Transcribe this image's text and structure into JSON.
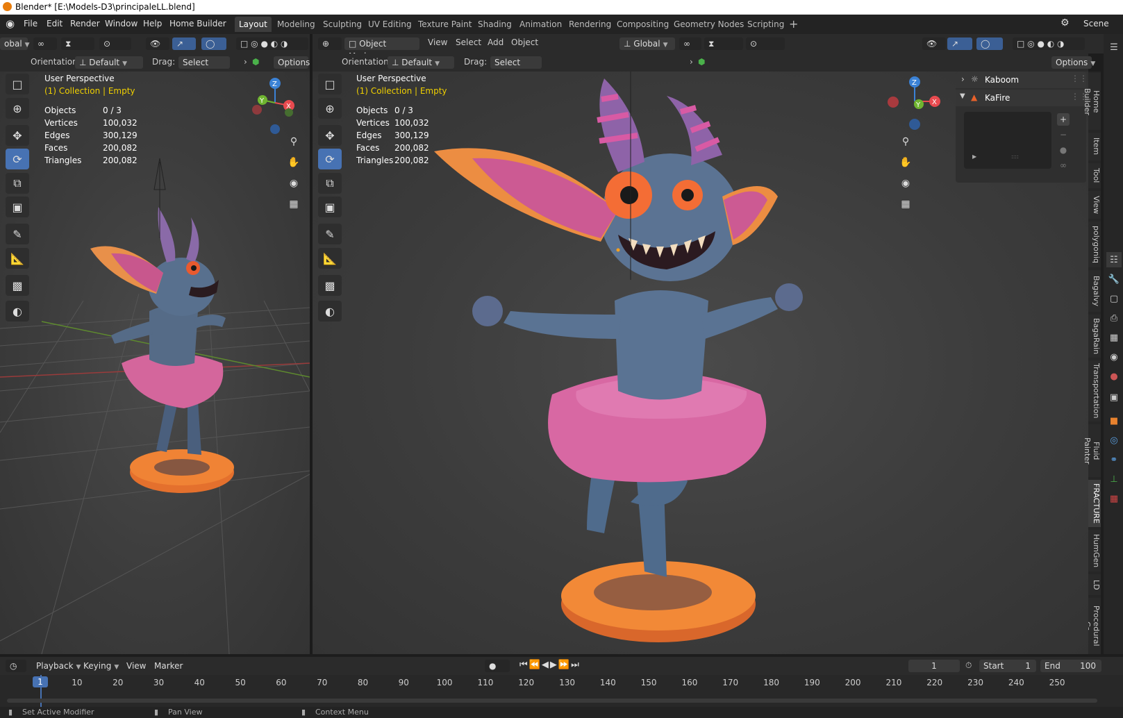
{
  "window": {
    "title": "Blender* [E:\\Models-D3\\principaleLL.blend]"
  },
  "menu": [
    "File",
    "Edit",
    "Render",
    "Window",
    "Help",
    "Home Builder"
  ],
  "workspaces": [
    {
      "label": "Layout",
      "active": true
    },
    {
      "label": "Modeling"
    },
    {
      "label": "Sculpting"
    },
    {
      "label": "UV Editing"
    },
    {
      "label": "Texture Paint"
    },
    {
      "label": "Shading"
    },
    {
      "label": "Animation"
    },
    {
      "label": "Rendering"
    },
    {
      "label": "Compositing"
    },
    {
      "label": "Geometry Nodes"
    },
    {
      "label": "Scripting"
    }
  ],
  "scene": {
    "label": "Scene"
  },
  "left_view": {
    "global_label": "obal",
    "orientation_label": "Orientation:",
    "orientation_value": "Default",
    "drag_label": "Drag:",
    "drag_value": "Select Box",
    "options_label": "Options",
    "overlay_title": "User Perspective",
    "overlay_collection": "(1) Collection | Empty",
    "stats": [
      {
        "label": "Objects",
        "value": "0 / 3"
      },
      {
        "label": "Vertices",
        "value": "100,032"
      },
      {
        "label": "Edges",
        "value": "300,129"
      },
      {
        "label": "Faces",
        "value": "200,082"
      },
      {
        "label": "Triangles",
        "value": "200,082"
      }
    ]
  },
  "main_view": {
    "mode_label": "Object Mode",
    "menus": [
      "View",
      "Select",
      "Add",
      "Object"
    ],
    "transform_label": "Global",
    "orientation_label": "Orientation:",
    "orientation_value": "Default",
    "drag_label": "Drag:",
    "drag_value": "Select Box",
    "options_label": "Options",
    "overlay_title": "User Perspective",
    "overlay_collection": "(1) Collection | Empty",
    "stats": [
      {
        "label": "Objects",
        "value": "0 / 3"
      },
      {
        "label": "Vertices",
        "value": "100,032"
      },
      {
        "label": "Edges",
        "value": "300,129"
      },
      {
        "label": "Faces",
        "value": "200,082"
      },
      {
        "label": "Triangles",
        "value": "200,082"
      }
    ]
  },
  "gizmo_axes": {
    "x": "X",
    "y": "Y",
    "z": "Z"
  },
  "sidebar_panel": {
    "items": [
      {
        "label": "Kaboom",
        "expanded": false
      },
      {
        "label": "KaFire",
        "expanded": true
      }
    ]
  },
  "sidebar_tabs": [
    "Home Builder",
    "Item",
    "Tool",
    "View",
    "polygoniq",
    "Bagalvy",
    "BagaRain",
    "Transportation",
    "Fluid Painter",
    "FRACTURE",
    "HumGen",
    "LD",
    "Procedural Cr"
  ],
  "active_sidebar_tab": "FRACTURE",
  "timeline": {
    "menus": [
      "Playback",
      "Keying",
      "View",
      "Marker"
    ],
    "current_frame": "1",
    "start_label": "Start",
    "start_value": "1",
    "end_label": "End",
    "end_value": "100",
    "ticks": [
      "1",
      "10",
      "20",
      "30",
      "40",
      "50",
      "60",
      "70",
      "80",
      "90",
      "100",
      "110",
      "120",
      "130",
      "140",
      "150",
      "160",
      "170",
      "180",
      "190",
      "200",
      "210",
      "220",
      "230",
      "240",
      "250"
    ]
  },
  "statusbar": [
    "Set Active Modifier",
    "Pan View",
    "Context Menu"
  ],
  "colors": {
    "accent": "#4772b3",
    "collection_text": "#f0d000",
    "x_axis": "#e84a4f",
    "y_axis": "#6fb530",
    "z_axis": "#3b82d6"
  }
}
